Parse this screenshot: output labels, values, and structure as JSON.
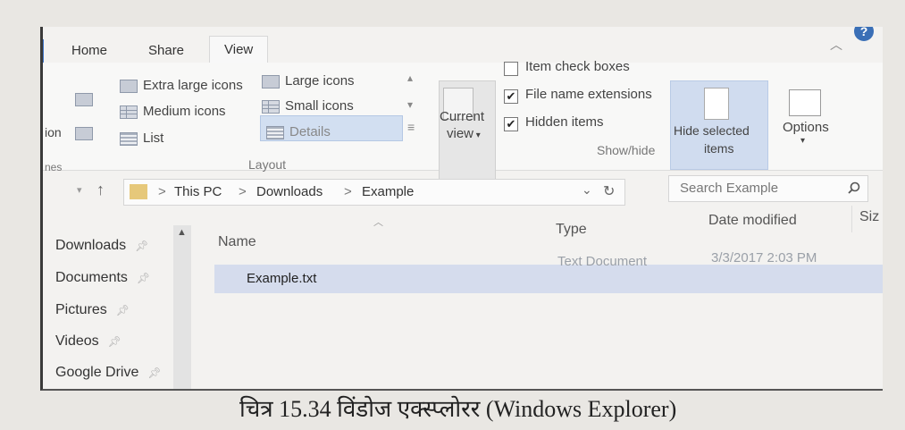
{
  "tabs": [
    "Home",
    "Share",
    "View"
  ],
  "help_label": "?",
  "ribbon": {
    "pane_cut": "ion",
    "pane_cut2": "nes",
    "layout": {
      "group_label": "Layout",
      "items": [
        "Extra large icons",
        "Large icons",
        "Medium icons",
        "Small icons",
        "List",
        "Details"
      ]
    },
    "current_view": {
      "line1": "Current",
      "line2": "view"
    },
    "show_hide": {
      "group_label": "Show/hide",
      "checkboxes": [
        {
          "label": "Item check boxes",
          "checked": false
        },
        {
          "label": "File name extensions",
          "checked": true
        },
        {
          "label": "Hidden items",
          "checked": true
        }
      ]
    },
    "hide_selected": {
      "line1": "Hide selected",
      "line2": "items"
    },
    "options": {
      "label": "Options"
    }
  },
  "address": {
    "crumbs": [
      "This PC",
      "Downloads",
      "Example"
    ],
    "separator": ">",
    "search_placeholder": "Search Example"
  },
  "nav_pane": [
    "Downloads",
    "Documents",
    "Pictures",
    "Videos",
    "Google Drive"
  ],
  "file_list": {
    "columns": [
      "Name",
      "Type",
      "Date modified",
      "Siz"
    ],
    "rows": [
      {
        "name": "Example.txt",
        "type": "Text Document",
        "date": "3/3/2017 2:03 PM"
      }
    ]
  },
  "caption": "चित्र 15.34 विंडोज एक्स्प्लोरर (Windows Explorer)"
}
